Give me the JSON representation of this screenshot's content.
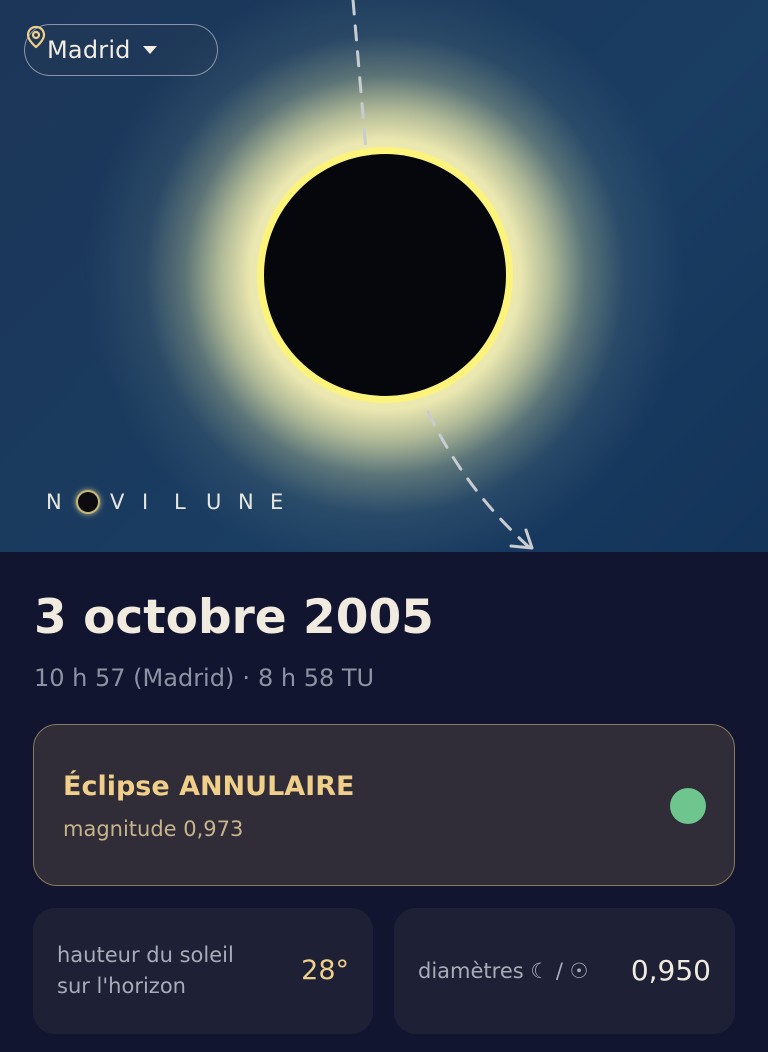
{
  "location": {
    "name": "Madrid"
  },
  "brand": {
    "letters": [
      "N",
      "V",
      "I",
      "L",
      "U",
      "N",
      "E"
    ]
  },
  "eclipse": {
    "date": "3 octobre 2005",
    "local_time": "10 h 57 (Madrid)",
    "separator": "·",
    "ut_time": "8 h 58 TU",
    "type_label": "Éclipse ANNULAIRE",
    "magnitude_label": "magnitude 0,973",
    "status_color": "#6fc58e"
  },
  "stats": {
    "sun_height_label_line1": "hauteur du soleil",
    "sun_height_label_line2": "sur l'horizon",
    "sun_height_value": "28°",
    "diameters_label": "diamètres ☾ / ☉",
    "diameters_value": "0,950"
  },
  "colors": {
    "accent_gold": "#f0cf8a",
    "background": "#111530",
    "status_green": "#6fc58e"
  }
}
